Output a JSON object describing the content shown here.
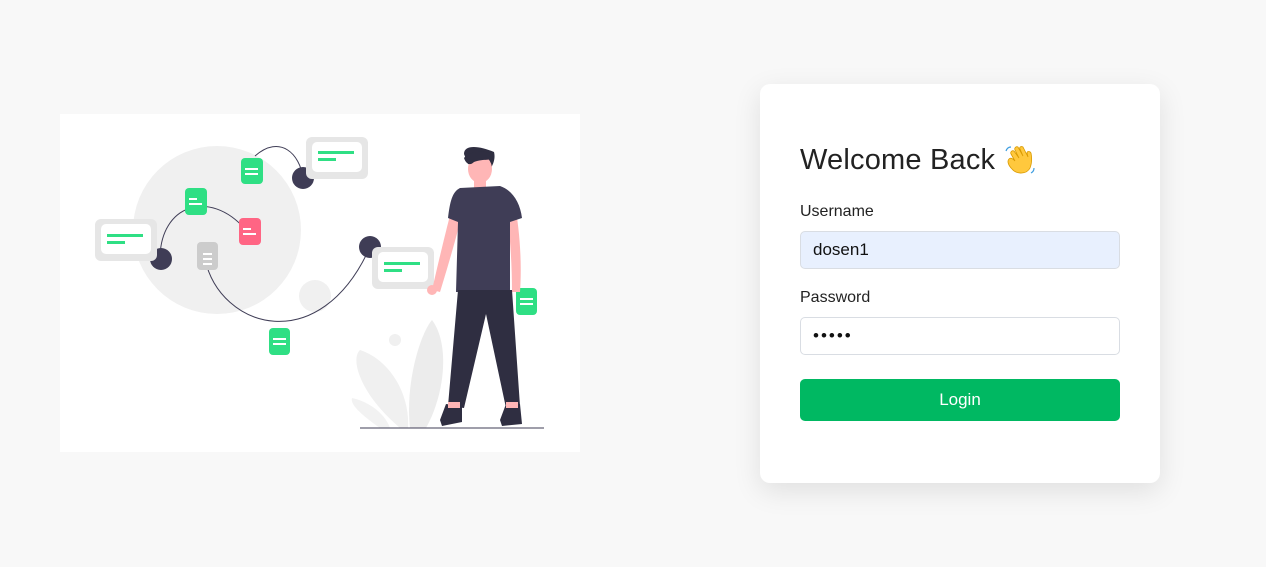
{
  "login": {
    "title": "Welcome Back",
    "wave_emoji_icon": "waving-hand-icon",
    "username_label": "Username",
    "username_value": "dosen1",
    "password_label": "Password",
    "password_value": "dosen",
    "login_button": "Login"
  },
  "colors": {
    "page_background": "#f8f8f8",
    "accent_green": "#00b862",
    "autofill_background": "#e8f0fe",
    "illustration_dark": "#3f3d56",
    "illustration_green": "#2fdf84",
    "illustration_pink": "#ff6584"
  },
  "illustration": {
    "icon": "people-network-illustration"
  }
}
